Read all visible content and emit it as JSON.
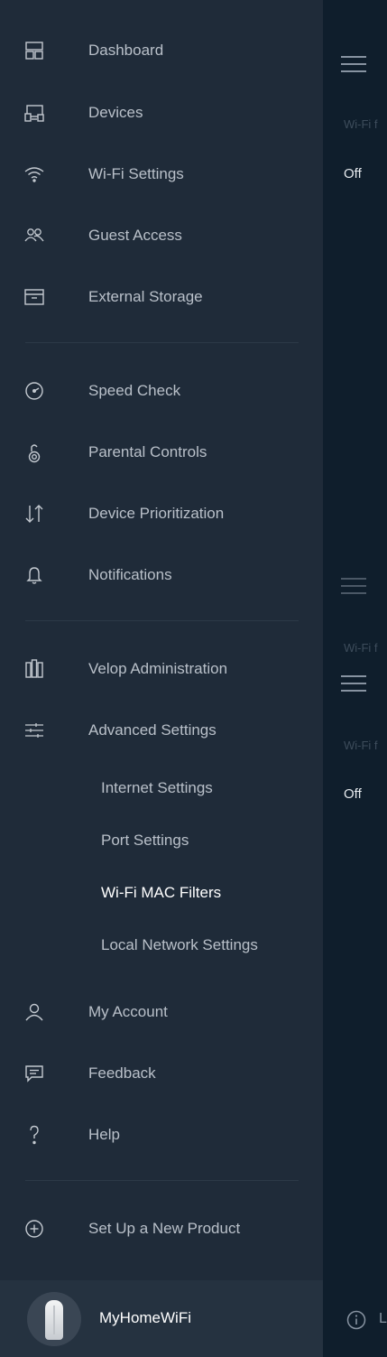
{
  "sidebar": {
    "items": [
      {
        "label": "Dashboard",
        "icon": "dashboard-icon"
      },
      {
        "label": "Devices",
        "icon": "devices-icon"
      },
      {
        "label": "Wi-Fi Settings",
        "icon": "wifi-icon"
      },
      {
        "label": "Guest Access",
        "icon": "guest-access-icon"
      },
      {
        "label": "External Storage",
        "icon": "external-storage-icon"
      },
      {
        "label": "Speed Check",
        "icon": "speedometer-icon"
      },
      {
        "label": "Parental Controls",
        "icon": "parental-controls-icon"
      },
      {
        "label": "Device Prioritization",
        "icon": "prioritization-arrows-icon"
      },
      {
        "label": "Notifications",
        "icon": "bell-icon"
      },
      {
        "label": "Velop Administration",
        "icon": "velop-nodes-icon"
      },
      {
        "label": "Advanced Settings",
        "icon": "sliders-icon"
      },
      {
        "label": "My Account",
        "icon": "user-icon"
      },
      {
        "label": "Feedback",
        "icon": "chat-bubble-icon"
      },
      {
        "label": "Help",
        "icon": "question-mark-icon"
      },
      {
        "label": "Set Up a New Product",
        "icon": "plus-circle-icon"
      }
    ],
    "advanced_subitems": [
      {
        "label": "Internet Settings",
        "active": false
      },
      {
        "label": "Port Settings",
        "active": false
      },
      {
        "label": "Wi-Fi MAC Filters",
        "active": true
      },
      {
        "label": "Local Network Settings",
        "active": false
      }
    ],
    "network": {
      "name": "MyHomeWiFi",
      "icon": "velop-router-icon"
    }
  },
  "background_content": {
    "labels": [
      "Wi-Fi f",
      "Wi-Fi f",
      "Wi-Fi f"
    ],
    "values": [
      "Off",
      "Off"
    ],
    "info_trailing": "L",
    "icons": [
      "hamburger-menu-icon",
      "info-icon"
    ]
  },
  "colors": {
    "sidebar_bg": "#1f2b39",
    "content_bg": "#0f1e2c",
    "text_muted": "#b9c0c9",
    "text_active": "#ffffff"
  }
}
